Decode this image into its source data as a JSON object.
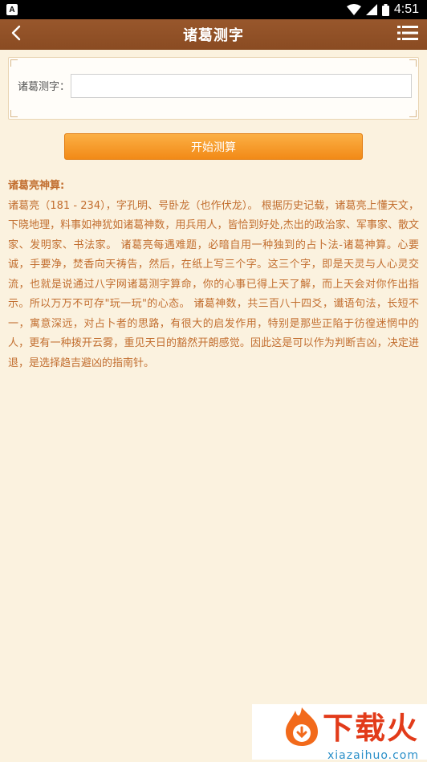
{
  "status_bar": {
    "app_letter": "A",
    "time": "4:51"
  },
  "header": {
    "title": "诸葛测字"
  },
  "form": {
    "label": "诸葛测字：",
    "input_value": "",
    "input_placeholder": ""
  },
  "action": {
    "start_label": "开始测算"
  },
  "description": {
    "title": "诸葛亮神算:",
    "body": "诸葛亮（181 - 234），字孔明、号卧龙（也作伏龙）。 根据历史记载，诸葛亮上懂天文，下晓地理，料事如神犹如诸葛神数，用兵用人，皆恰到好处,杰出的政治家、军事家、散文家、发明家、书法家。 诸葛亮每遇难题，必暗自用一种独到的占卜法-诸葛神算。心要诚，手要净，焚香向天祷告，然后，在纸上写三个字。这三个字，即是天灵与人心灵交流，也就是说通过八字网诸葛测字算命，你的心事已得上天了解，而上天会对你作出指示。所以万万不可存\"玩一玩\"的心态。 诸葛神数，共三百八十四爻，谶语句法，长短不一，寓意深远，对占卜者的思路，有很大的启发作用，特别是那些正陷于彷徨迷惘中的人，更有一种拨开云雾，重见天日的豁然开朗感觉。因此这是可以作为判断吉凶，决定进退，是选择趋吉避凶的指南针。"
  },
  "watermark": {
    "name": "下载火",
    "url": "xiazaihuo.com"
  },
  "colors": {
    "header_bg": "#8f4f25",
    "page_bg": "#fbf2df",
    "button_orange": "#f59a2a",
    "text_brown": "#c26e2f"
  },
  "icons": {
    "back": "chevron-left-icon",
    "menu": "menu-list-icon",
    "wifi": "wifi-icon",
    "signal": "signal-icon",
    "battery": "battery-icon"
  }
}
